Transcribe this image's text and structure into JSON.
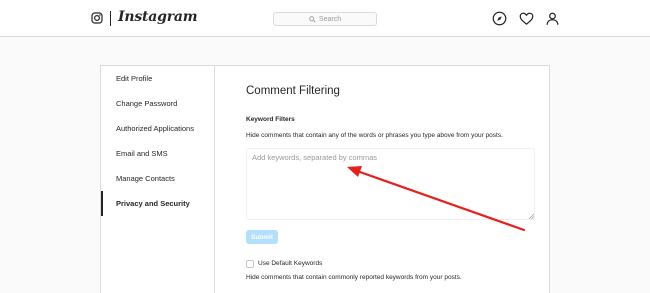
{
  "header": {
    "brand": "Instagram",
    "search_placeholder": "Search",
    "icons": [
      "instagram-logo-icon",
      "search-icon",
      "compass-icon",
      "heart-icon",
      "profile-icon"
    ]
  },
  "sidebar": {
    "items": [
      {
        "label": "Edit Profile"
      },
      {
        "label": "Change Password"
      },
      {
        "label": "Authorized Applications"
      },
      {
        "label": "Email and SMS"
      },
      {
        "label": "Manage Contacts"
      },
      {
        "label": "Privacy and Security",
        "active": true
      }
    ]
  },
  "main": {
    "title": "Comment Filtering",
    "keyword_filters": {
      "label": "Keyword Filters",
      "description": "Hide comments that contain any of the words or phrases you type above from your posts.",
      "placeholder": "Add keywords, separated by commas",
      "value": ""
    },
    "submit_label": "Submit",
    "default_keywords": {
      "label": "Use Default Keywords",
      "checked": false,
      "description": "Hide comments that contain commonly reported keywords from your posts."
    }
  },
  "annotation": {
    "arrow_color": "#e8201c"
  },
  "colors": {
    "background": "#fafafa",
    "border": "#dbdbdb",
    "text": "#262626",
    "placeholder": "#999999",
    "submit_disabled": "#b2dffc"
  }
}
